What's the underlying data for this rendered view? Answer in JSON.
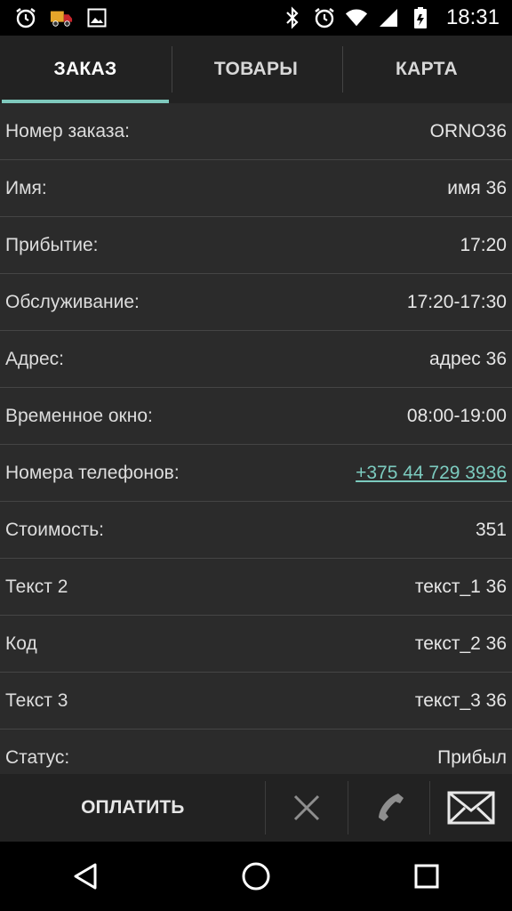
{
  "status_bar": {
    "left_icons": [
      "alarm-icon",
      "truck-icon",
      "image-icon"
    ],
    "right_icons": [
      "bluetooth-icon",
      "alarm-icon",
      "wifi-icon",
      "signal-icon",
      "battery-icon"
    ],
    "time": "18:31"
  },
  "tabs": [
    {
      "label": "ЗАКАЗ",
      "active": true
    },
    {
      "label": "ТОВАРЫ",
      "active": false
    },
    {
      "label": "КАРТА",
      "active": false
    }
  ],
  "details": [
    {
      "label": "Номер заказа:",
      "value": "ORNO36"
    },
    {
      "label": "Имя:",
      "value": "имя 36"
    },
    {
      "label": "Прибытие:",
      "value": "17:20"
    },
    {
      "label": "Обслуживание:",
      "value": "17:20-17:30"
    },
    {
      "label": "Адрес:",
      "value": "адрес 36"
    },
    {
      "label": "Временное окно:",
      "value": "08:00-19:00"
    },
    {
      "label": "Номера телефонов:",
      "value": "+375 44 729 3936"
    },
    {
      "label": "Стоимость:",
      "value": "351"
    },
    {
      "label": "Текст 2",
      "value": "текст_1 36"
    },
    {
      "label": "Код",
      "value": "текст_2 36"
    },
    {
      "label": "Текст 3",
      "value": "текст_3 36"
    },
    {
      "label": "Статус:",
      "value": "Прибыл"
    }
  ],
  "actions": {
    "pay_label": "ОПЛАТИТЬ",
    "icons": [
      "close-icon",
      "phone-icon",
      "mail-icon"
    ]
  },
  "nav": {
    "icons": [
      "back-icon",
      "home-icon",
      "recents-icon"
    ]
  },
  "colors": {
    "accent": "#7fc9bd",
    "background": "#2b2b2b",
    "bar": "#222222"
  }
}
